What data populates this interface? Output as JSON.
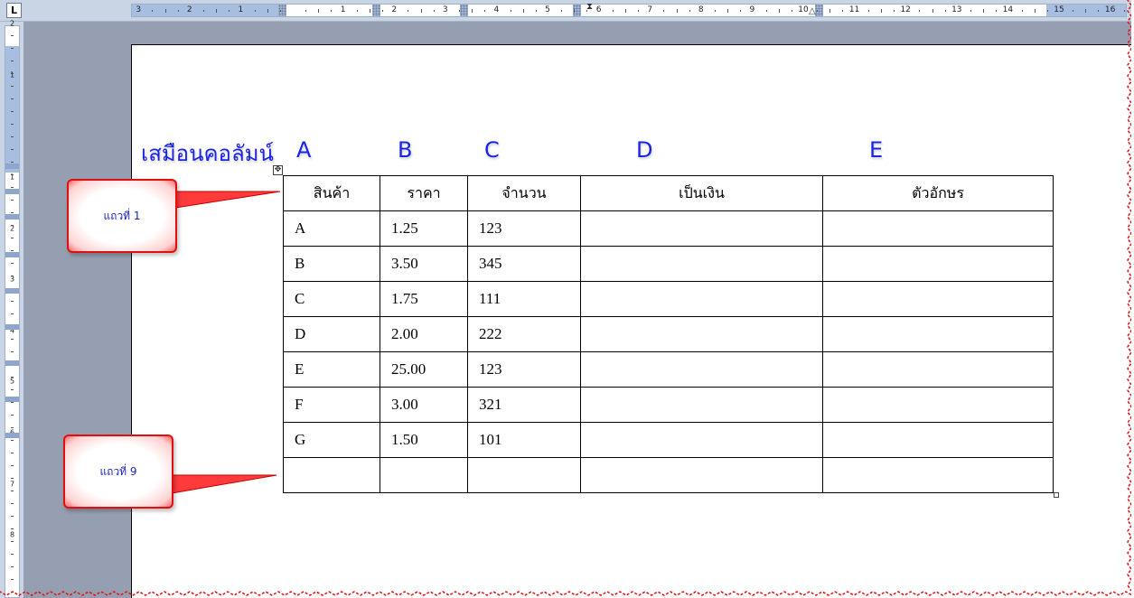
{
  "ruler": {
    "corner_label": "L",
    "top_labels": [
      "3",
      "2",
      "1",
      "1",
      "2",
      "3",
      "4",
      "5",
      "6",
      "7",
      "8",
      "9",
      "10",
      "11",
      "12",
      "13",
      "14",
      "15",
      "16"
    ],
    "left_labels": [
      "2",
      "1",
      "1",
      "2",
      "3",
      "4",
      "5",
      "6",
      "7",
      "8"
    ]
  },
  "heading": {
    "title": "เสมือนคอลัมน์",
    "letters": [
      "A",
      "B",
      "C",
      "D",
      "E"
    ]
  },
  "table": {
    "headers": [
      "สินค้า",
      "ราคา",
      "จำนวน",
      "เป็นเงิน",
      "ตัวอักษร"
    ],
    "rows": [
      [
        "A",
        "1.25",
        "123",
        "",
        ""
      ],
      [
        "B",
        "3.50",
        "345",
        "",
        ""
      ],
      [
        "C",
        "1.75",
        "111",
        "",
        ""
      ],
      [
        "D",
        "2.00",
        "222",
        "",
        ""
      ],
      [
        "E",
        "25.00",
        "123",
        "",
        ""
      ],
      [
        "F",
        "3.00",
        "321",
        "",
        ""
      ],
      [
        "G",
        "1.50",
        "101",
        "",
        ""
      ],
      [
        "",
        "",
        "",
        "",
        ""
      ]
    ]
  },
  "callouts": {
    "row1": "แถวที่ 1",
    "row9": "แถวที่ 9"
  },
  "icons": {
    "table_move": "move-handle-icon",
    "table_resize": "resize-handle-icon"
  },
  "colors": {
    "heading_text": "#1a24e8",
    "callout_border": "#e01010",
    "workspace_gray": "#969fb1",
    "ruler_blue": "#a8bee0"
  }
}
